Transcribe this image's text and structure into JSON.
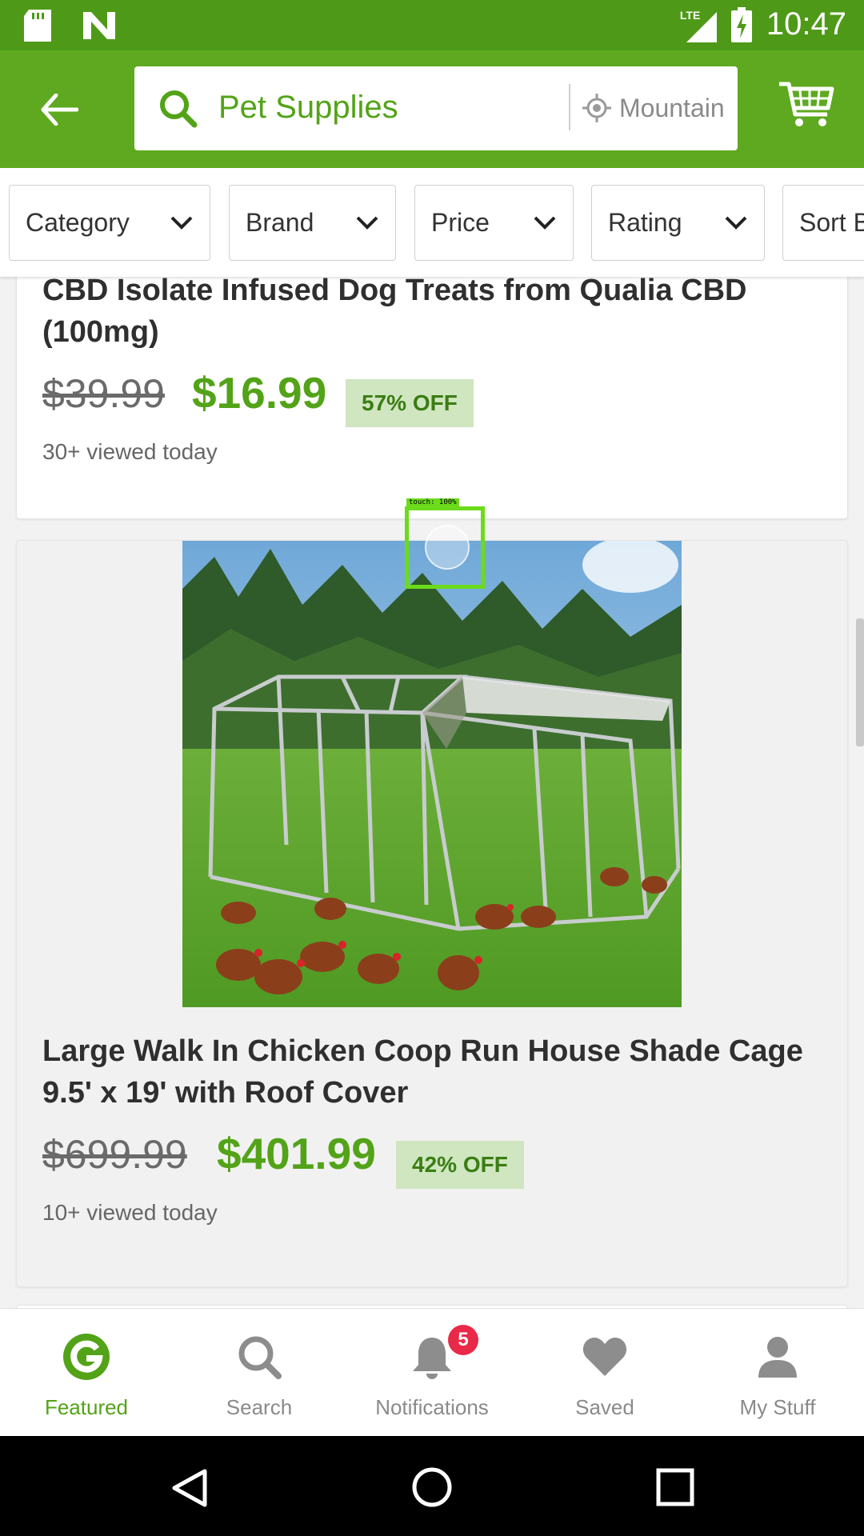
{
  "status_bar": {
    "time": "10:47",
    "network": "LTE"
  },
  "header": {
    "search_text": "Pet Supplies",
    "location_text": "Mountain View"
  },
  "filters": [
    "Category",
    "Brand",
    "Price",
    "Rating",
    "Sort By"
  ],
  "products": [
    {
      "title": "CBD Isolate Infused Dog Treats from Qualia CBD (100mg)",
      "old_price": "$39.99",
      "new_price": "$16.99",
      "discount": "57% OFF",
      "viewed": "30+ viewed today"
    },
    {
      "title": "Large Walk In Chicken Coop Run House Shade Cage 9.5' x 19' with Roof Cover",
      "old_price": "$699.99",
      "new_price": "$401.99",
      "discount": "42% OFF",
      "viewed": "10+ viewed today"
    }
  ],
  "touch_label": "touch: 100%",
  "bottom_nav": [
    {
      "label": "Featured",
      "icon": "groupon-g-icon",
      "active": true
    },
    {
      "label": "Search",
      "icon": "search-icon",
      "active": false
    },
    {
      "label": "Notifications",
      "icon": "bell-icon",
      "active": false,
      "badge": "5"
    },
    {
      "label": "Saved",
      "icon": "heart-icon",
      "active": false
    },
    {
      "label": "My Stuff",
      "icon": "person-icon",
      "active": false
    }
  ],
  "colors": {
    "brand_green": "#53a318",
    "header_green": "#5ea91f",
    "status_green": "#4e9a18",
    "badge_red": "#e82a48"
  }
}
